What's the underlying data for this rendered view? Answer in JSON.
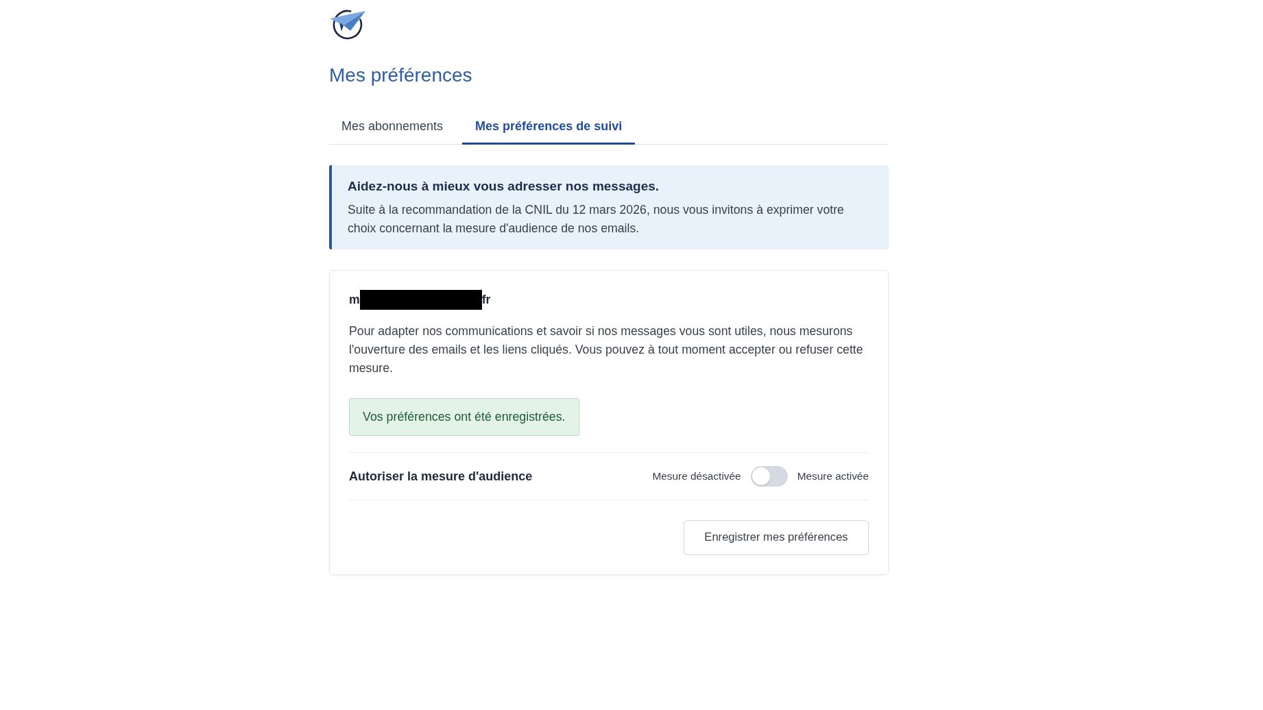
{
  "page_title": "Mes préférences",
  "tabs": [
    {
      "label": "Mes abonnements",
      "selected": false
    },
    {
      "label": "Mes préférences de suivi",
      "selected": true
    }
  ],
  "notice": {
    "title": "Aidez-nous à mieux vous adresser nos messages.",
    "text": "Suite à la recommandation de la CNIL du 12 mars 2026, nous vous invitons à exprimer votre choix concernant la mesure d'audience de nos emails."
  },
  "card": {
    "email": {
      "start": "m",
      "end": "fr",
      "redacted": true
    },
    "description": "Pour adapter nos communications et savoir si nos messages vous sont utiles, nous mesurons l'ouverture des emails et les liens cliqués. Vous pouvez à tout moment accepter ou refuser cette mesure.",
    "success_message": "Vos préférences ont été enregistrées.",
    "setting": {
      "label": "Autoriser la mesure d'audience",
      "off_label": "Mesure désactivée",
      "on_label": "Mesure activée",
      "on": false
    },
    "save_button": "Enregistrer mes préférences"
  }
}
